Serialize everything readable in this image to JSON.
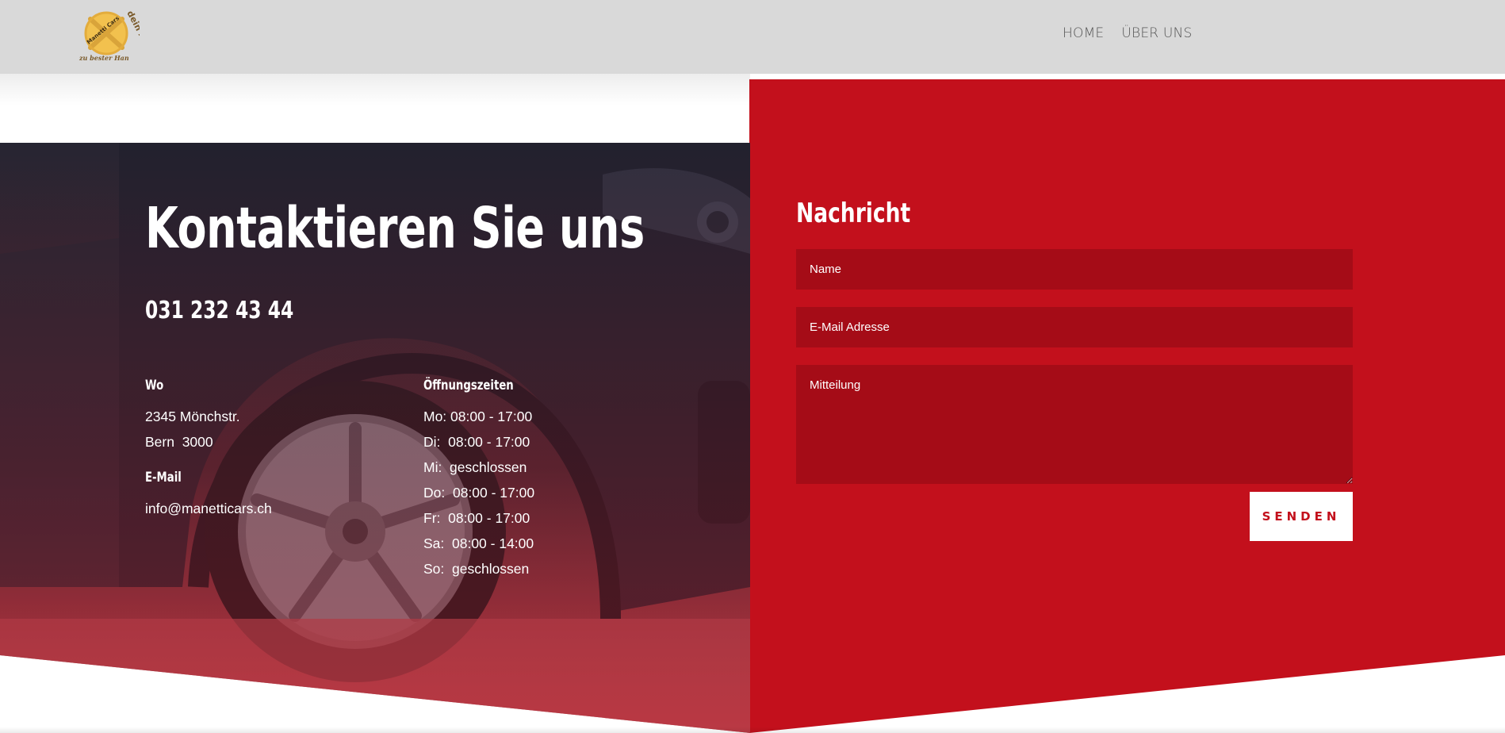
{
  "header": {
    "logo": {
      "icon": "logo-tire-icon",
      "text_top": "dein Auto",
      "text_middle": "Manetti Cars",
      "text_bottom": "zu bester Han"
    },
    "nav": [
      {
        "label": "HOME"
      },
      {
        "label": "ÜBER UNS"
      }
    ]
  },
  "contact": {
    "title": "Kontaktieren Sie uns",
    "phone": "031 232 43 44",
    "where_label": "Wo",
    "address_line1": "2345 Mönchstr.",
    "address_line2": "Bern  3000",
    "email_label": "E-Mail",
    "email": "info@manetticars.ch",
    "hours_label": "Öffnungszeiten",
    "hours": [
      "Mo: 08:00 - 17:00",
      "Di:  08:00 - 17:00",
      "Mi:  geschlossen",
      "Do:  08:00 - 17:00",
      "Fr:  08:00 - 17:00",
      "Sa:  08:00 - 14:00",
      "So:  geschlossen"
    ]
  },
  "form": {
    "title": "Nachricht",
    "name_placeholder": "Name",
    "email_placeholder": "E-Mail Adresse",
    "message_placeholder": "Mitteilung",
    "submit_label": "SENDEN"
  },
  "colors": {
    "brand_red": "#c3101c",
    "field_red": "#a50c17",
    "header_gray": "#d9d9d9"
  }
}
